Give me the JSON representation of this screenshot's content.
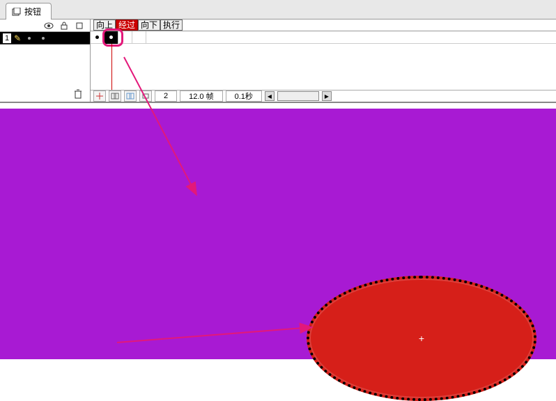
{
  "tab": {
    "title": "按钮"
  },
  "layer": {
    "number": "1"
  },
  "frame_headers": {
    "items": [
      {
        "label": "向上"
      },
      {
        "label": "经过",
        "selected": true
      },
      {
        "label": "向下"
      },
      {
        "label": "执行"
      }
    ]
  },
  "status": {
    "current_frame": "2",
    "fps": "12.0 帧",
    "elapsed": "0.1秒"
  },
  "colors": {
    "canvas": "#a81ad3",
    "ellipse_fill": "#d61f19",
    "highlight": "#e3187a"
  }
}
